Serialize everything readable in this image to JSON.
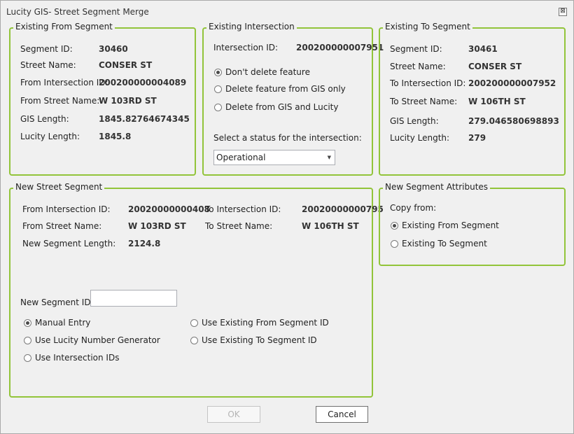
{
  "window": {
    "title": "Lucity GIS- Street Segment Merge",
    "close_glyph": "⊠"
  },
  "from_segment": {
    "legend": "Existing From Segment",
    "rows": [
      {
        "label": "Segment ID:",
        "value": "30460"
      },
      {
        "label": "Street Name:",
        "value": "CONSER ST"
      },
      {
        "label": "From Intersection ID:",
        "value": "200200000004089"
      },
      {
        "label": "From Street Name:",
        "value": "W 103RD ST"
      },
      {
        "label": "GIS Length:",
        "value": "1845.82764674345"
      },
      {
        "label": "Lucity Length:",
        "value": "1845.8"
      }
    ]
  },
  "intersection": {
    "legend": "Existing Intersection",
    "id_label": "Intersection ID:",
    "id_value": "200200000007951",
    "options": [
      {
        "label": "Don't delete feature",
        "checked": true
      },
      {
        "label": "Delete feature from GIS only",
        "checked": false
      },
      {
        "label": "Delete from GIS and Lucity",
        "checked": false
      }
    ],
    "status_label": "Select a status for the intersection:",
    "status_value": "Operational",
    "dropdown_glyph": "▼"
  },
  "to_segment": {
    "legend": "Existing To Segment",
    "rows": [
      {
        "label": "Segment ID:",
        "value": "30461"
      },
      {
        "label": "Street Name:",
        "value": "CONSER ST"
      },
      {
        "label": "To Intersection ID:",
        "value": "200200000007952"
      },
      {
        "label": "To Street Name:",
        "value": "W 106TH ST"
      },
      {
        "label": "GIS Length:",
        "value": "279.046580698893"
      },
      {
        "label": "Lucity Length:",
        "value": "279"
      }
    ]
  },
  "new_segment": {
    "legend": "New Street Segment",
    "from_int_label": "From Intersection ID:",
    "from_int_value": "20020000000408",
    "to_int_label": "To Intersection ID:",
    "to_int_value": "20020000000795",
    "from_street_label": "From Street Name:",
    "from_street_value": "W 103RD ST",
    "to_street_label": "To Street Name:",
    "to_street_value": "W 106TH ST",
    "length_label": "New Segment Length:",
    "length_value": "2124.8",
    "id_label": "New Segment ID",
    "id_value": "",
    "options_left": [
      {
        "label": "Manual Entry",
        "checked": true
      },
      {
        "label": "Use Lucity Number Generator",
        "checked": false
      },
      {
        "label": "Use Intersection IDs",
        "checked": false
      }
    ],
    "options_right": [
      {
        "label": "Use Existing From Segment ID",
        "checked": false
      },
      {
        "label": "Use Existing To Segment ID",
        "checked": false
      }
    ]
  },
  "attributes": {
    "legend": "New Segment Attributes",
    "copy_label": "Copy from:",
    "options": [
      {
        "label": "Existing From Segment",
        "checked": true
      },
      {
        "label": "Existing To Segment",
        "checked": false
      }
    ]
  },
  "footer": {
    "ok_label": "OK",
    "cancel_label": "Cancel"
  },
  "colors": {
    "group_border": "#92c43a",
    "background": "#f0f0f0"
  }
}
